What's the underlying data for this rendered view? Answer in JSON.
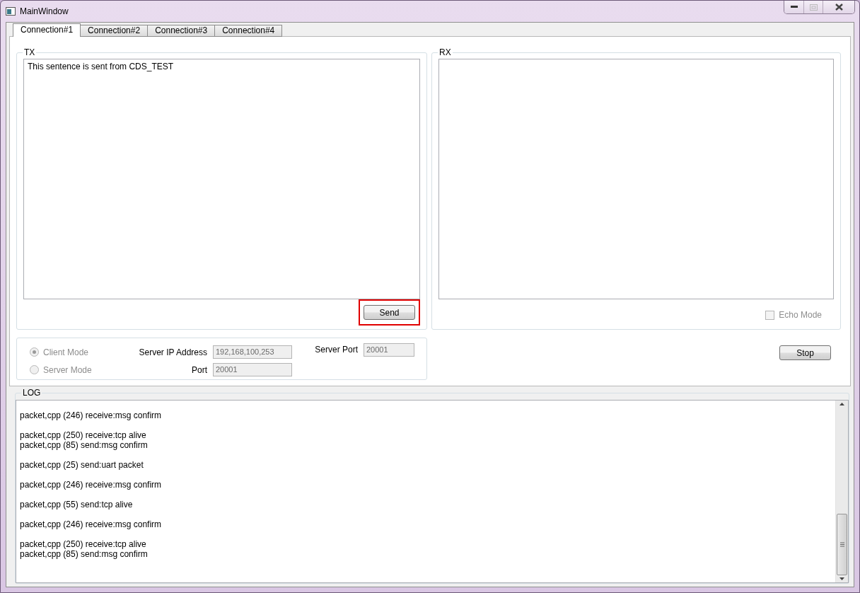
{
  "window": {
    "title": "MainWindow"
  },
  "tabs": [
    {
      "label": "Connection#1",
      "selected": true
    },
    {
      "label": "Connection#2",
      "selected": false
    },
    {
      "label": "Connection#3",
      "selected": false
    },
    {
      "label": "Connection#4",
      "selected": false
    }
  ],
  "tx": {
    "title": "TX",
    "value": "This sentence is sent from CDS_TEST",
    "send_button": {
      "label": "Send",
      "highlighted": true
    }
  },
  "rx": {
    "title": "RX",
    "echo_mode": {
      "label": "Echo Mode",
      "checked": false,
      "disabled": true
    }
  },
  "settings": {
    "modes": [
      {
        "label": "Client Mode",
        "selected": true,
        "disabled": true
      },
      {
        "label": "Server Mode",
        "selected": false,
        "disabled": true
      }
    ],
    "server_ip": {
      "label": "Server IP Address",
      "value": "192,168,100,253",
      "disabled": true
    },
    "port": {
      "label": "Port",
      "value": "20001",
      "disabled": true
    },
    "server_port": {
      "label": "Server Port",
      "value": "20001",
      "disabled": true
    }
  },
  "stop_button": {
    "label": "Stop"
  },
  "log": {
    "title": "LOG",
    "groups": [
      {
        "lines": [
          "packet,cpp (246) receive:msg confirm"
        ]
      },
      {
        "lines": [
          "packet,cpp (250) receive:tcp alive",
          "packet,cpp (85) send:msg confirm"
        ]
      },
      {
        "lines": [
          "packet,cpp (25) send:uart packet"
        ]
      },
      {
        "lines": [
          "packet,cpp (246) receive:msg confirm"
        ]
      },
      {
        "lines": [
          "packet,cpp (55) send:tcp alive"
        ]
      },
      {
        "lines": [
          "packet,cpp (246) receive:msg confirm"
        ]
      },
      {
        "lines": [
          "packet,cpp (250) receive:tcp alive",
          "packet,cpp (85) send:msg confirm"
        ]
      }
    ]
  }
}
